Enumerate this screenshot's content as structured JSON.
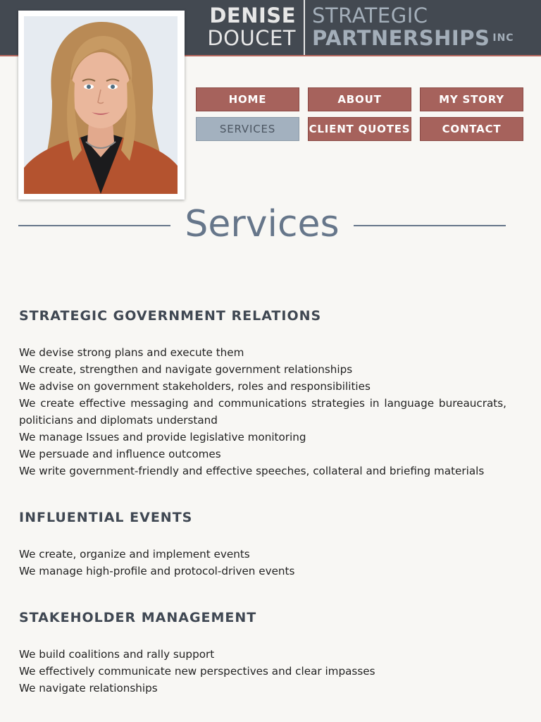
{
  "header": {
    "first_name": "DENISE",
    "last_name": "DOUCET",
    "company_line1": "STRATEGIC",
    "company_line2": "PARTNERSHIPS",
    "company_suffix": "INC"
  },
  "nav": {
    "items": [
      {
        "label": "HOME",
        "active": false
      },
      {
        "label": "ABOUT",
        "active": false
      },
      {
        "label": "MY STORY",
        "active": false
      },
      {
        "label": "SERVICES",
        "active": true
      },
      {
        "label": "CLIENT QUOTES",
        "active": false
      },
      {
        "label": "CONTACT",
        "active": false
      }
    ]
  },
  "page": {
    "title": "Services"
  },
  "sections": [
    {
      "heading": "STRATEGIC GOVERNMENT RELATIONS",
      "items": [
        "We devise strong plans and execute them",
        "We create, strengthen and navigate government relationships",
        "We advise on government stakeholders, roles and responsibilities",
        "We create effective messaging and communications strategies in language bureaucrats, politicians and diplomats understand",
        "We manage Issues and provide legislative monitoring",
        "We persuade and influence outcomes",
        "We write government-friendly and effective speeches, collateral and briefing materials"
      ]
    },
    {
      "heading": "INFLUENTIAL EVENTS",
      "items": [
        "We create, organize and implement events",
        "We manage high-profile and protocol-driven events"
      ]
    },
    {
      "heading": "STAKEHOLDER MANAGEMENT",
      "items": [
        "We build coalitions and rally support",
        "We effectively communicate new perspectives and clear impasses",
        "We navigate relationships"
      ]
    }
  ],
  "colors": {
    "header_bg": "#434951",
    "accent_red": "#a6625c",
    "active_nav": "#a3b1bf",
    "title_slate": "#66768a",
    "page_bg": "#f8f7f4"
  }
}
